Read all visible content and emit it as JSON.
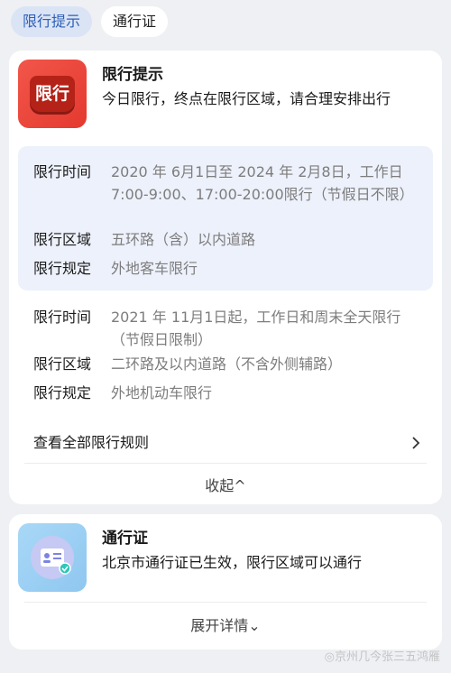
{
  "tabs": [
    {
      "label": "限行提示"
    },
    {
      "label": "通行证"
    }
  ],
  "restriction_card": {
    "icon_text": "限行",
    "title": "限行提示",
    "subtitle": "今日限行，终点在限行区域，请合理安排出行",
    "rule_sets": [
      {
        "time_label": "限行时间",
        "time_value": "2020 年 6月1日至 2024 年 2月8日，工作日7:00-9:00、17:00-20:00限行（节假日不限）",
        "area_label": "限行区域",
        "area_value": "五环路（含）以内道路",
        "rule_label": "限行规定",
        "rule_value": "外地客车限行"
      },
      {
        "time_label": "限行时间",
        "time_value": "2021 年 11月1日起，工作日和周末全天限行（节假日限制）",
        "area_label": "限行区域",
        "area_value": "二环路及以内道路（不含外侧辅路）",
        "rule_label": "限行规定",
        "rule_value": "外地机动车限行"
      }
    ],
    "view_all_label": "查看全部限行规则",
    "collapse_label": "收起^"
  },
  "pass_card": {
    "title": "通行证",
    "subtitle": "北京市通行证已生效，限行区域可以通行",
    "expand_label": "展开详情⌄"
  },
  "watermark": "◎京州几今张三五鸿雁",
  "colors": {
    "accent_blue": "#2d5fb8",
    "icon_red": "#e4392f",
    "rule_highlight_bg": "#edf1fb"
  },
  "icons": {
    "restriction": "restriction-icon",
    "pass": "id-card-icon",
    "chevron": "chevron-right-icon"
  }
}
